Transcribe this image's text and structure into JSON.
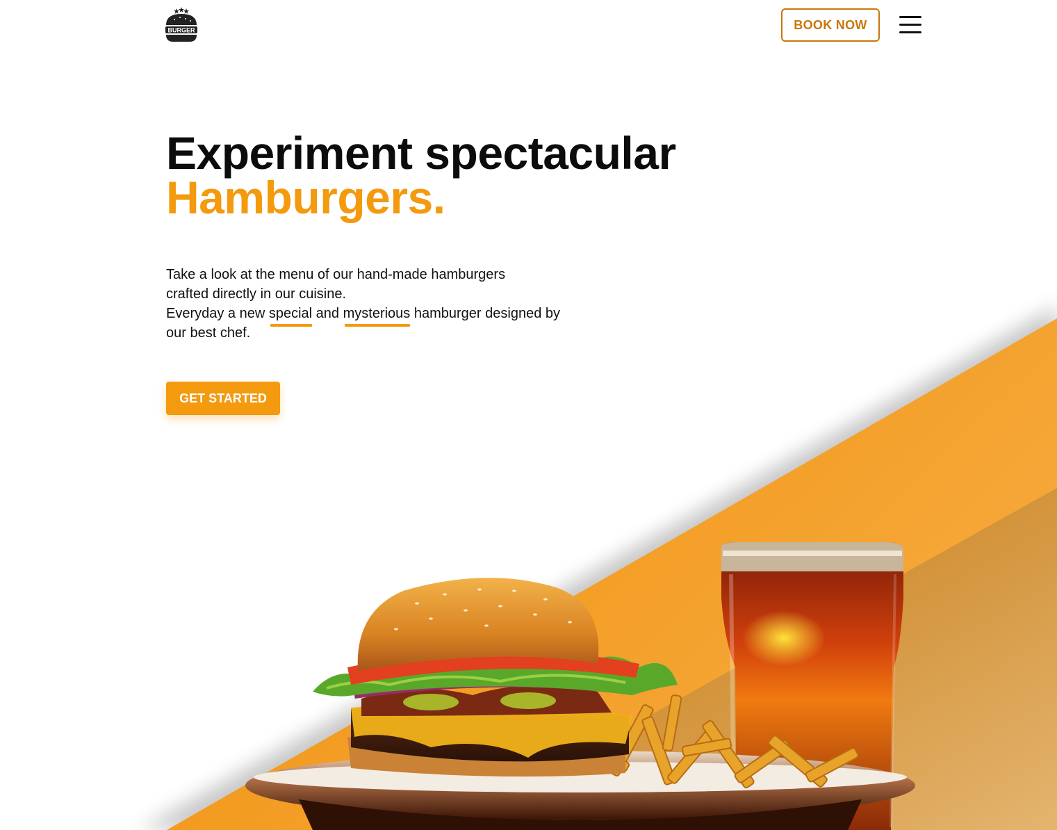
{
  "header": {
    "logo_text": "BURGER",
    "book_label": "BOOK NOW"
  },
  "hero": {
    "title_line1": "Experiment spectacular",
    "title_line2": "Hamburgers.",
    "desc_line1": "Take a look at the menu of our hand-made hamburgers",
    "desc_line2": "crafted directly in our cuisine.",
    "desc_line3_a": "Everyday a new ",
    "desc_highlight1": "special",
    "desc_line3_b": " and ",
    "desc_highlight2": "mysterious",
    "desc_line3_c": " hamburger designed by",
    "desc_line4": "our best chef.",
    "cta_label": "GET STARTED"
  },
  "colors": {
    "accent": "#f39a0f",
    "accent_dark": "#c9770a",
    "text": "#0c0c0c"
  },
  "icons": {
    "logo": "burger-logo-icon",
    "menu": "hamburger-menu-icon"
  }
}
